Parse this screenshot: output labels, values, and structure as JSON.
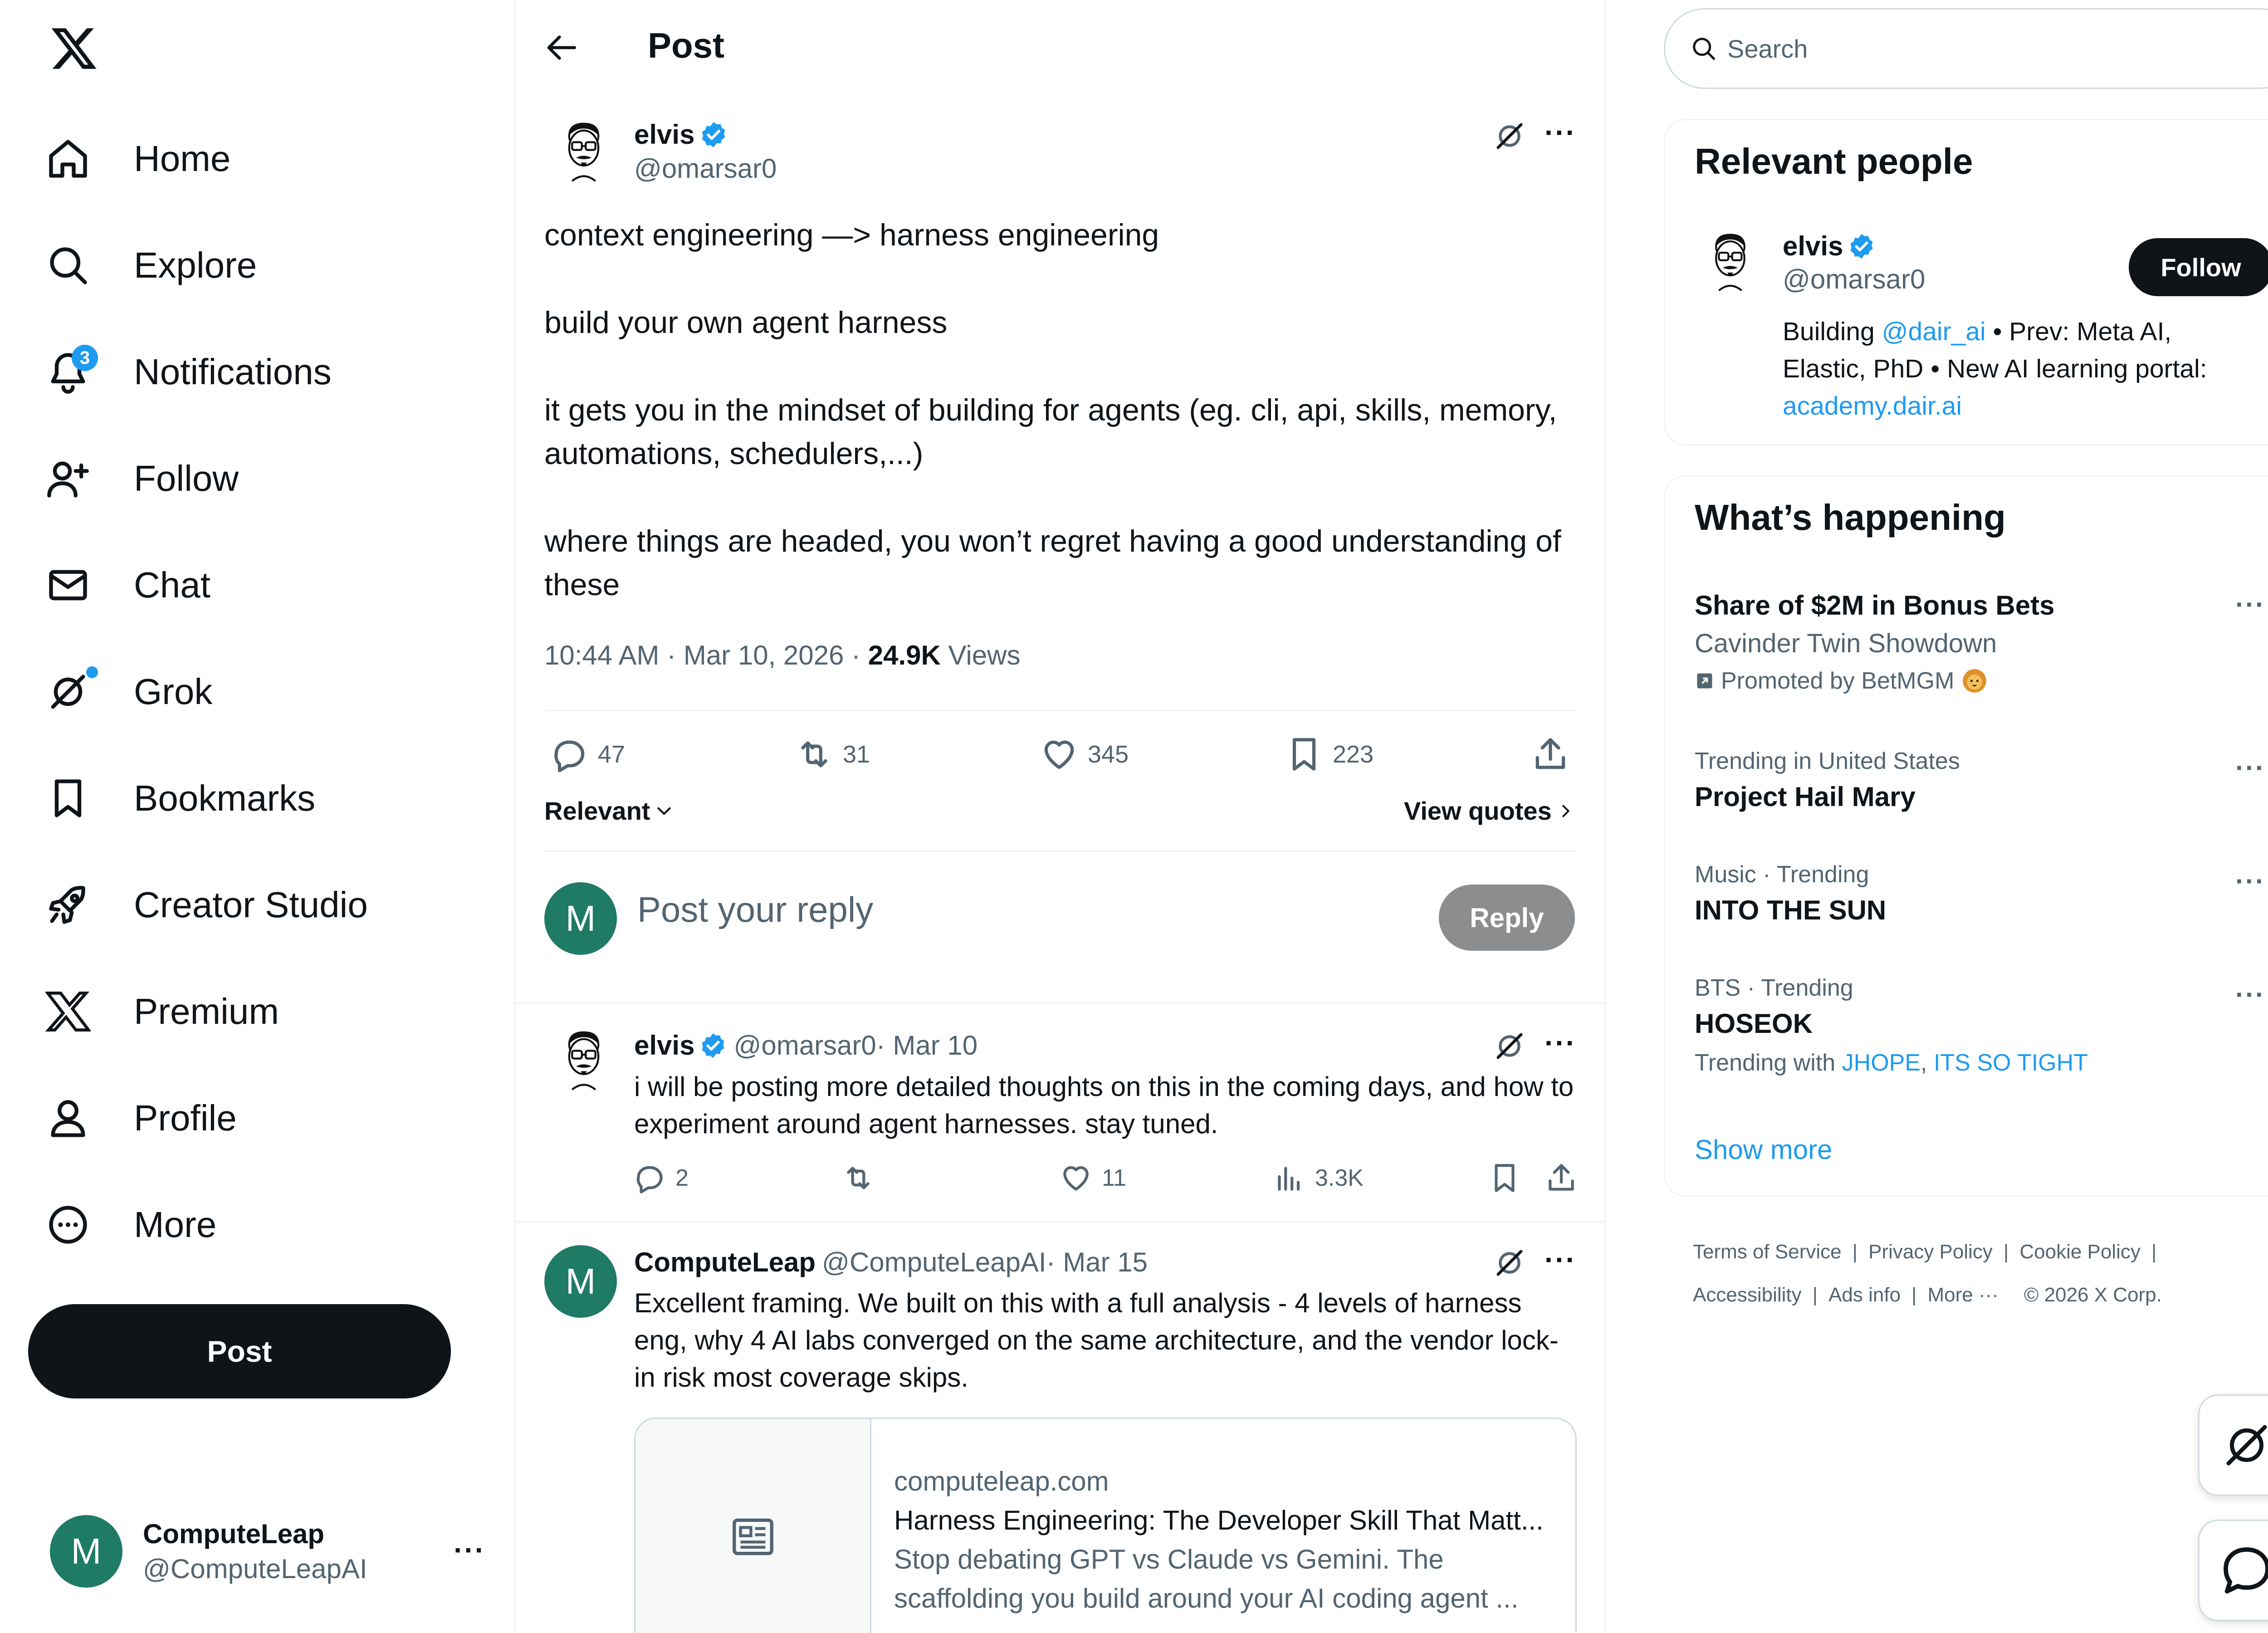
{
  "nav": {
    "items": [
      {
        "label": "Home"
      },
      {
        "label": "Explore"
      },
      {
        "label": "Notifications",
        "badge": "3"
      },
      {
        "label": "Follow"
      },
      {
        "label": "Chat"
      },
      {
        "label": "Grok"
      },
      {
        "label": "Bookmarks"
      },
      {
        "label": "Creator Studio"
      },
      {
        "label": "Premium"
      },
      {
        "label": "Profile"
      },
      {
        "label": "More"
      }
    ],
    "post_label": "Post"
  },
  "account": {
    "avatar_letter": "M",
    "name": "ComputeLeap",
    "handle": "@ComputeLeapAI",
    "more": "···"
  },
  "header": {
    "title": "Post"
  },
  "post": {
    "author": {
      "name": "elvis",
      "handle": "@omarsar0"
    },
    "paragraphs": [
      "context engineering —> harness engineering",
      "build your own agent harness",
      "it gets you in the mindset of building for agents (eg. cli, api, skills, memory, automations, schedulers,...)",
      "where things are headed, you won’t regret having a good understanding of these"
    ],
    "time": "10:44 AM · Mar 10, 2026 · ",
    "views_count": "24.9K",
    "views_label": " Views",
    "actions": {
      "replies": "47",
      "reposts": "31",
      "likes": "345",
      "bookmarks": "223"
    },
    "more": "···"
  },
  "replies_bar": {
    "sort_label": "Relevant",
    "view_quotes": "View quotes"
  },
  "composer": {
    "avatar_letter": "M",
    "placeholder": "Post your reply",
    "reply_label": "Reply"
  },
  "replies": [
    {
      "name": "elvis",
      "handle": "@omarsar0",
      "date": " · Mar 10",
      "text": "i will be posting more detailed thoughts on this in the coming days, and how to experiment around agent harnesses. stay tuned.",
      "replies": "2",
      "likes": "11",
      "views": "3.3K",
      "more": "···"
    },
    {
      "avatar_letter": "M",
      "name": "ComputeLeap",
      "handle": "@ComputeLeapAI",
      "date": " · Mar 15",
      "text": "Excellent framing. We built on this with a full analysis - 4 levels of harness eng, why 4 AI labs converged on the same architecture, and the vendor lock-in risk most coverage skips.",
      "more": "···",
      "card": {
        "domain": "computeleap.com",
        "title": "Harness Engineering: The Developer Skill That Matt...",
        "description_1": "Stop debating GPT vs Claude vs Gemini. The",
        "description_2": "scaffolding you build around your AI coding agent ..."
      }
    }
  ],
  "search": {
    "placeholder": "Search"
  },
  "relevant_people": {
    "title": "Relevant people",
    "name": "elvis",
    "handle": "@omarsar0",
    "follow_label": "Follow",
    "bio_1_prefix": "Building ",
    "bio_1_link": "@dair_ai",
    "bio_1_suffix": " • Prev: Meta AI,",
    "bio_2": "Elastic, PhD • New AI learning portal:",
    "bio_3_link": "academy.dair.ai"
  },
  "whats_happening": {
    "title": "What’s happening",
    "promo": {
      "name": "Share of $2M in Bonus Bets",
      "subtitle": "Cavinder Twin Showdown",
      "promoted": "Promoted by BetMGM"
    },
    "trends": [
      {
        "context": "Trending in United States",
        "name": "Project Hail Mary"
      },
      {
        "context": "Music · Trending",
        "name": "INTO THE SUN"
      },
      {
        "context": "BTS · Trending",
        "name": "HOSEOK",
        "with_label": "Trending with ",
        "with_1": "JHOPE",
        "with_sep": ", ",
        "with_2": "ITS SO TIGHT"
      }
    ],
    "more": "···",
    "show_more": "Show more"
  },
  "footer": {
    "links": [
      "Terms of Service",
      "Privacy Policy",
      "Cookie Policy",
      "Accessibility",
      "Ads info",
      "More ···"
    ],
    "separator": "|",
    "copyright": "© 2026 X Corp."
  },
  "colors": {
    "accent": "#1d9bf0",
    "text": "#0f1419",
    "muted": "#536471",
    "avatar": "#1f7a66",
    "border": "#eff3f4"
  }
}
